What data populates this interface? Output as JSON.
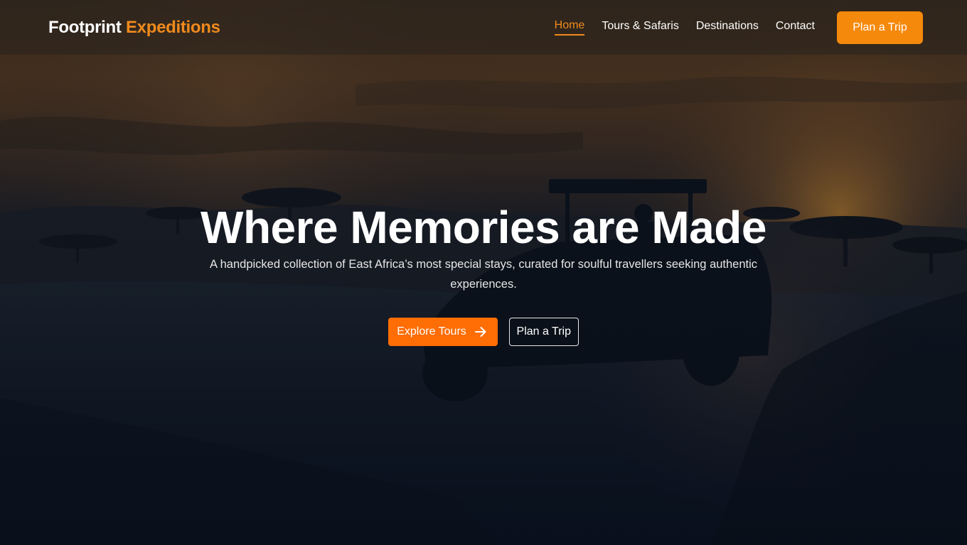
{
  "brand": {
    "name": "Footprint",
    "accent": "Expeditions"
  },
  "nav": {
    "items": [
      {
        "label": "Home",
        "active": true
      },
      {
        "label": "Tours & Safaris",
        "active": false
      },
      {
        "label": "Destinations",
        "active": false
      },
      {
        "label": "Contact",
        "active": false
      }
    ],
    "cta_label": "Plan a Trip"
  },
  "hero": {
    "title": "Where Memories are Made",
    "subtitle": "A handpicked collection of East Africa’s most special stays, curated for soulful travellers seeking authentic experiences.",
    "primary_button": {
      "label": "Explore Tours",
      "icon": "arrow-right-icon"
    },
    "secondary_button": {
      "label": "Plan a Trip"
    },
    "background": "safari-sunset-jeep-photo"
  },
  "colors": {
    "accent": "#f08a1c",
    "button_orange": "#ff6d05",
    "nav_button": "#f5890b",
    "text": "#ffffff"
  }
}
